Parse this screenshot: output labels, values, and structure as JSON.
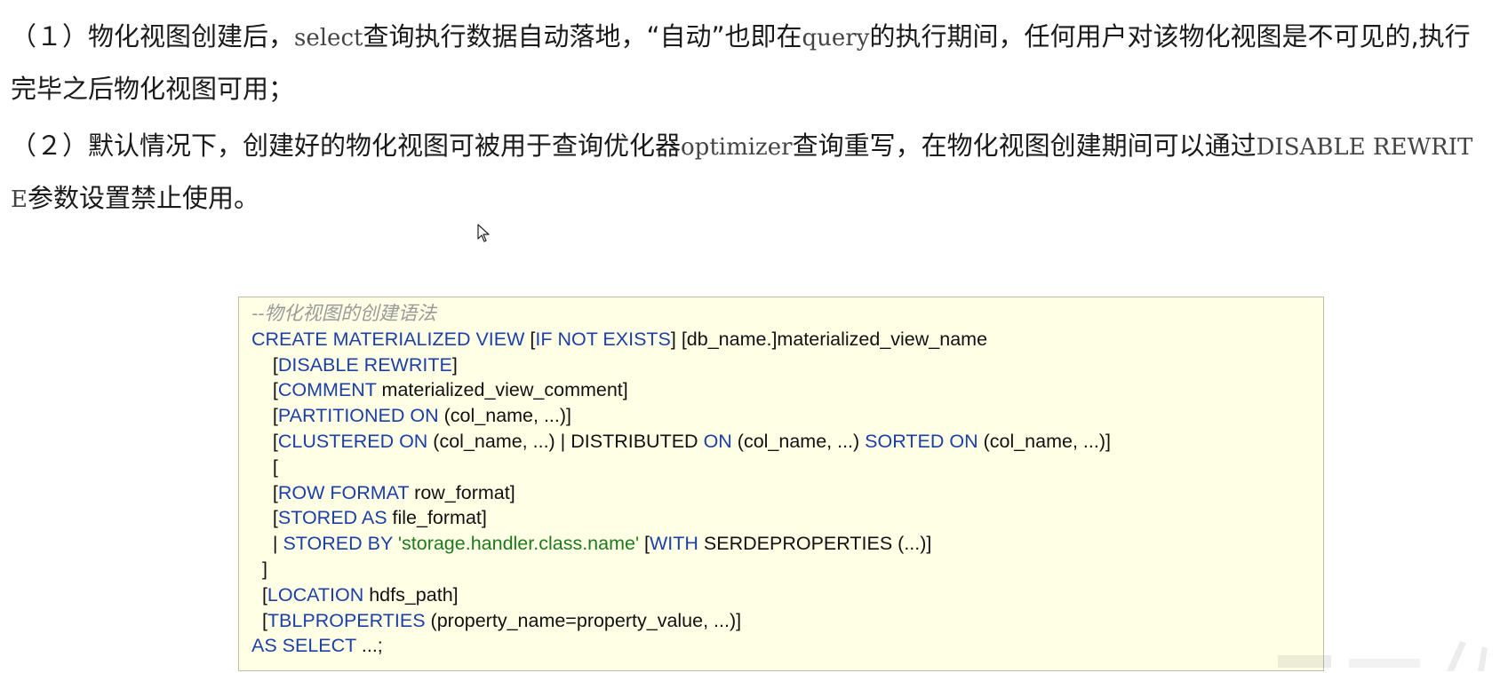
{
  "paragraphs": [
    {
      "segments": [
        {
          "t": "（１）物化视图创建后，",
          "mono": false
        },
        {
          "t": "select",
          "mono": true
        },
        {
          "t": "查询执行数据自动落地，“自动”也即在",
          "mono": false
        },
        {
          "t": "query",
          "mono": true
        },
        {
          "t": "的执行期间，任何用户对该物化视图是不可见的,执行完毕之后物化视图可用；",
          "mono": false
        }
      ]
    },
    {
      "segments": [
        {
          "t": "（２）默认情况下，创建好的物化视图可被用于查询优化器",
          "mono": false
        },
        {
          "t": "optimizer",
          "mono": true
        },
        {
          "t": "查询重写，在物化视图创建期间可以通过",
          "mono": false
        },
        {
          "t": "DISABLE REWRITE",
          "mono": true
        },
        {
          "t": "参数设置禁止使用。",
          "mono": false
        }
      ]
    }
  ],
  "code": {
    "lines": [
      [
        {
          "c": "cm",
          "t": "--物化视图的创建语法"
        }
      ],
      [
        {
          "c": "kw",
          "t": "CREATE MATERIALIZED VIEW "
        },
        {
          "c": "tx",
          "t": "["
        },
        {
          "c": "kw",
          "t": "IF NOT EXISTS"
        },
        {
          "c": "tx",
          "t": "] [db_name.]materialized_view_name"
        }
      ],
      [
        {
          "c": "tx",
          "t": "    ["
        },
        {
          "c": "kw",
          "t": "DISABLE REWRITE"
        },
        {
          "c": "tx",
          "t": "]"
        }
      ],
      [
        {
          "c": "tx",
          "t": "    ["
        },
        {
          "c": "kw",
          "t": "COMMENT"
        },
        {
          "c": "tx",
          "t": " materialized_view_comment]"
        }
      ],
      [
        {
          "c": "tx",
          "t": "    ["
        },
        {
          "c": "kw",
          "t": "PARTITIONED ON"
        },
        {
          "c": "tx",
          "t": " (col_name, ...)]"
        }
      ],
      [
        {
          "c": "tx",
          "t": "    ["
        },
        {
          "c": "kw",
          "t": "CLUSTERED ON"
        },
        {
          "c": "tx",
          "t": " (col_name, ...) | DISTRIBUTED "
        },
        {
          "c": "kw",
          "t": "ON"
        },
        {
          "c": "tx",
          "t": " (col_name, ...) "
        },
        {
          "c": "kw",
          "t": "SORTED ON"
        },
        {
          "c": "tx",
          "t": " (col_name, ...)]"
        }
      ],
      [
        {
          "c": "tx",
          "t": "    ["
        }
      ],
      [
        {
          "c": "tx",
          "t": "    ["
        },
        {
          "c": "kw",
          "t": "ROW FORMAT"
        },
        {
          "c": "tx",
          "t": " row_format]"
        }
      ],
      [
        {
          "c": "tx",
          "t": "    ["
        },
        {
          "c": "kw",
          "t": "STORED AS"
        },
        {
          "c": "tx",
          "t": " file_format]"
        }
      ],
      [
        {
          "c": "tx",
          "t": "    | "
        },
        {
          "c": "kw",
          "t": "STORED BY "
        },
        {
          "c": "st",
          "t": "'storage.handler.class.name'"
        },
        {
          "c": "tx",
          "t": " ["
        },
        {
          "c": "kw",
          "t": "WITH"
        },
        {
          "c": "tx",
          "t": " SERDEPROPERTIES (...)]"
        }
      ],
      [
        {
          "c": "tx",
          "t": "  ]"
        }
      ],
      [
        {
          "c": "tx",
          "t": "  ["
        },
        {
          "c": "kw",
          "t": "LOCATION"
        },
        {
          "c": "tx",
          "t": " hdfs_path]"
        }
      ],
      [
        {
          "c": "tx",
          "t": "  ["
        },
        {
          "c": "kw",
          "t": "TBLPROPERTIES"
        },
        {
          "c": "tx",
          "t": " (property_name=property_value, ...)]"
        }
      ],
      [
        {
          "c": "kw",
          "t": "AS SELECT"
        },
        {
          "c": "tx",
          "t": " ...;"
        }
      ]
    ]
  },
  "icons": {
    "cursor": "mouse-pointer-icon"
  },
  "colors": {
    "keyword": "#1c3fa8",
    "string": "#1f7a1f",
    "comment": "#9a9a9a",
    "code_background": "#ffffe6"
  }
}
